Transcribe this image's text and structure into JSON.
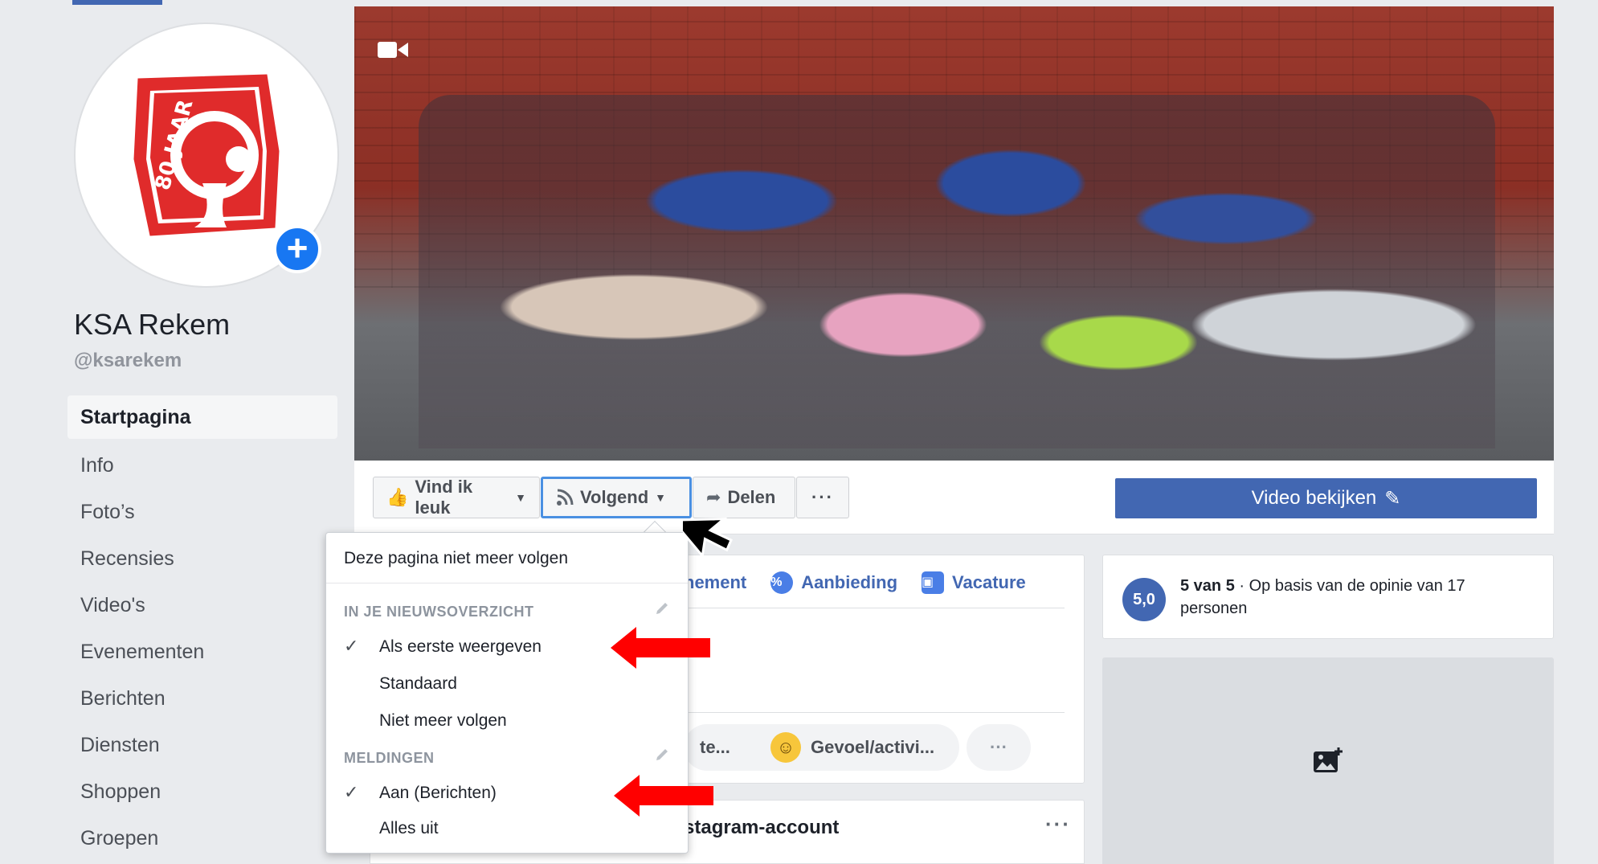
{
  "page": {
    "name": "KSA Rekem",
    "handle": "@ksarekem",
    "logo_text": "80 JAAR"
  },
  "left_nav": {
    "items": [
      {
        "label": "Startpagina",
        "active": true
      },
      {
        "label": "Info"
      },
      {
        "label": "Foto’s"
      },
      {
        "label": "Recensies"
      },
      {
        "label": "Video's"
      },
      {
        "label": "Evenementen"
      },
      {
        "label": "Berichten"
      },
      {
        "label": "Diensten"
      },
      {
        "label": "Shoppen"
      },
      {
        "label": "Groepen"
      }
    ]
  },
  "actions": {
    "like_label": "Vind ik leuk",
    "follow_label": "Volgend",
    "share_label": "Delen",
    "more_label": "···",
    "video_label": "Video bekijken"
  },
  "dropdown": {
    "unfollow_page": "Deze pagina niet meer volgen",
    "news_feed_header": "IN JE NIEUWSOVERZICHT",
    "news_feed_options": [
      "Als eerste weergeven",
      "Standaard",
      "Niet meer volgen"
    ],
    "news_feed_selected": "Als eerste weergeven",
    "notifications_header": "MELDINGEN",
    "notification_options": [
      "Aan (Berichten)",
      "Alles uit"
    ],
    "notification_selected": "Aan (Berichten)"
  },
  "composer": {
    "tabs": [
      "nement",
      "Aanbieding",
      "Vacature"
    ],
    "pill_1": "te...",
    "pill_2": "Gevoel/activi...",
    "pill_3": "···"
  },
  "instagram": {
    "title": "stagram-account",
    "more": "···"
  },
  "rating": {
    "badge": "5,0",
    "score": "5 van 5",
    "text": " · Op basis van de opinie van 17 personen"
  },
  "colors": {
    "brand_blue": "#4267b2",
    "highlight_border": "#4a90e2",
    "annotation_red": "#ff0000",
    "logo_red": "#e02b2b"
  }
}
